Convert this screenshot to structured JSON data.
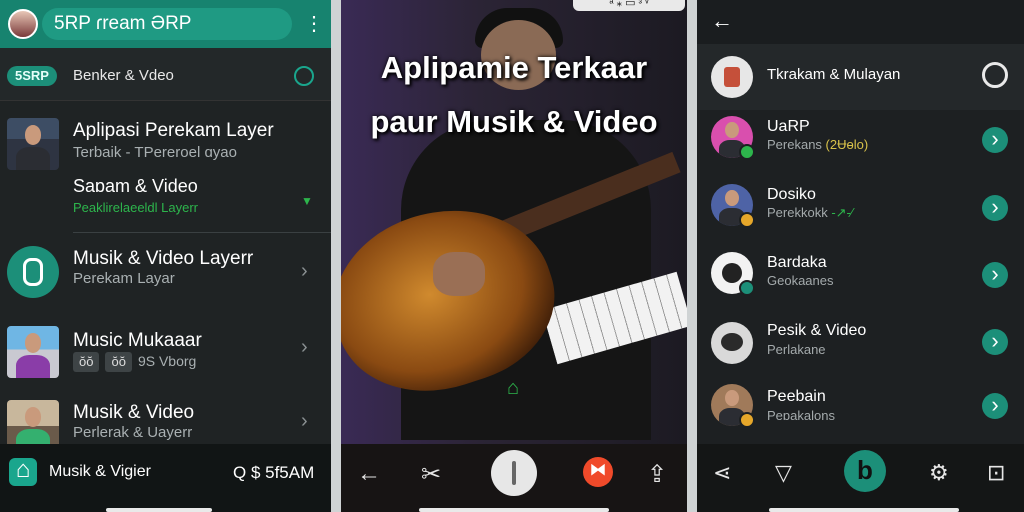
{
  "left_panel": {
    "header": {
      "title": "5RP ɾream ƏRP",
      "menu_icon": "kebab-menu-icon"
    },
    "subheader": {
      "badge": "5SRP",
      "title": "Benker & Vdeo",
      "icon": "circle-toggle-icon"
    },
    "items": [
      {
        "title": "Aplipasi Perekam Layer",
        "subtitle": "Terbaik - TPereroel ɑyao",
        "thumb": "person-thumbnail"
      },
      {
        "title": "Saɒam & Video",
        "subtitle": "Peaklirelaeeldl Layerr"
      },
      {
        "title": "Musik & Video Layerr",
        "subtitle": "Perekam Layar",
        "thumb": "app-logo-icon"
      },
      {
        "title": "Music Mukaaar",
        "chip1": "ŏŏ",
        "chip2": "ŏŏ",
        "subtitle": "9S Vborg",
        "thumb": "person-thumbnail"
      },
      {
        "title": "Musik & Video",
        "subtitle": "Perlerak & Uayerr",
        "thumb": "person-thumbnail"
      }
    ],
    "bottom": {
      "label": "Musik & Vigier",
      "time": "Q $ 5f5AM"
    }
  },
  "center_panel": {
    "status": "ᵃ ⁎ ▭ ᶟ ᵛ",
    "title_line1": "Aplipamie Terkaar",
    "title_line2": "paur Musik & Video",
    "watermark": "⌂"
  },
  "right_panel": {
    "items": [
      {
        "title": "Tkrakam & Mulayan",
        "subtitle": ""
      },
      {
        "title": "UaRP",
        "subtitle": "Perekans",
        "tag": "(2Ʉɵlo)"
      },
      {
        "title": "Dosiko",
        "subtitle": "Perekkokk",
        "tag": "-↗-∕"
      },
      {
        "title": "Bardaka",
        "subtitle": "Geokaanes"
      },
      {
        "title": "Pesik & Video",
        "subtitle": "Perlakane"
      },
      {
        "title": "Peebain",
        "subtitle": "Peɒakalons"
      }
    ]
  },
  "colors": {
    "teal": "#17836f",
    "teal_light": "#1c8f79",
    "green": "#2db54c",
    "record": "#f04a2a"
  }
}
